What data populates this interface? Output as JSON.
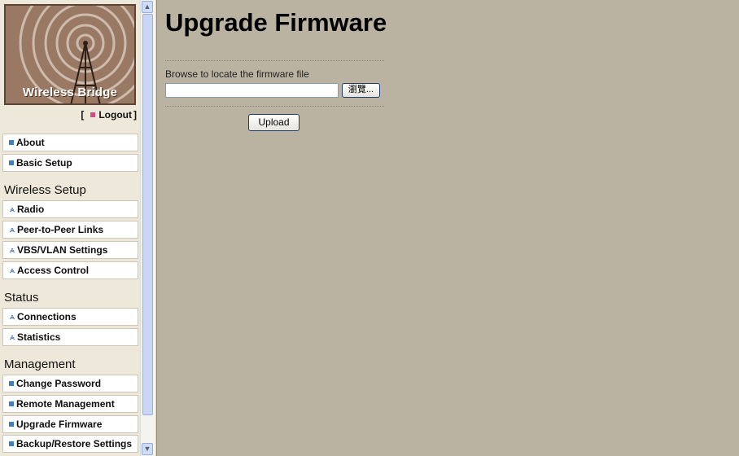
{
  "sidebar": {
    "logo_text": "Wireless  Bridge",
    "logout": {
      "open": "[",
      "label": "Logout",
      "close": "]"
    },
    "items": [
      {
        "label": "About",
        "icon": "square-bullet-icon"
      },
      {
        "label": "Basic Setup",
        "icon": "square-bullet-icon"
      }
    ],
    "sections": [
      {
        "title": "Wireless Setup",
        "items": [
          {
            "label": "Radio",
            "icon": "wireless-icon"
          },
          {
            "label": "Peer-to-Peer Links",
            "icon": "wireless-icon"
          },
          {
            "label": "VBS/VLAN Settings",
            "icon": "wireless-icon"
          },
          {
            "label": "Access Control",
            "icon": "wireless-icon"
          }
        ]
      },
      {
        "title": "Status",
        "items": [
          {
            "label": "Connections",
            "icon": "wireless-icon"
          },
          {
            "label": "Statistics",
            "icon": "wireless-icon"
          }
        ]
      },
      {
        "title": "Management",
        "items": [
          {
            "label": "Change Password",
            "icon": "square-bullet-icon"
          },
          {
            "label": "Remote Management",
            "icon": "square-bullet-icon"
          },
          {
            "label": "Upgrade Firmware",
            "icon": "square-bullet-icon"
          },
          {
            "label": "Backup/Restore Settings",
            "icon": "square-bullet-icon"
          }
        ]
      }
    ]
  },
  "main": {
    "title": "Upgrade Firmware",
    "browse_label": "Browse to locate the firmware file",
    "file_value": "",
    "browse_button": "瀏覽...",
    "upload_button": "Upload"
  },
  "colors": {
    "content_bg": "#bab3a2",
    "sidebar_bg": "#eee8da",
    "logo_bg": "#9a7964",
    "bullet_blue": "#3e7fbf",
    "logout_pink": "#d04c8a"
  }
}
